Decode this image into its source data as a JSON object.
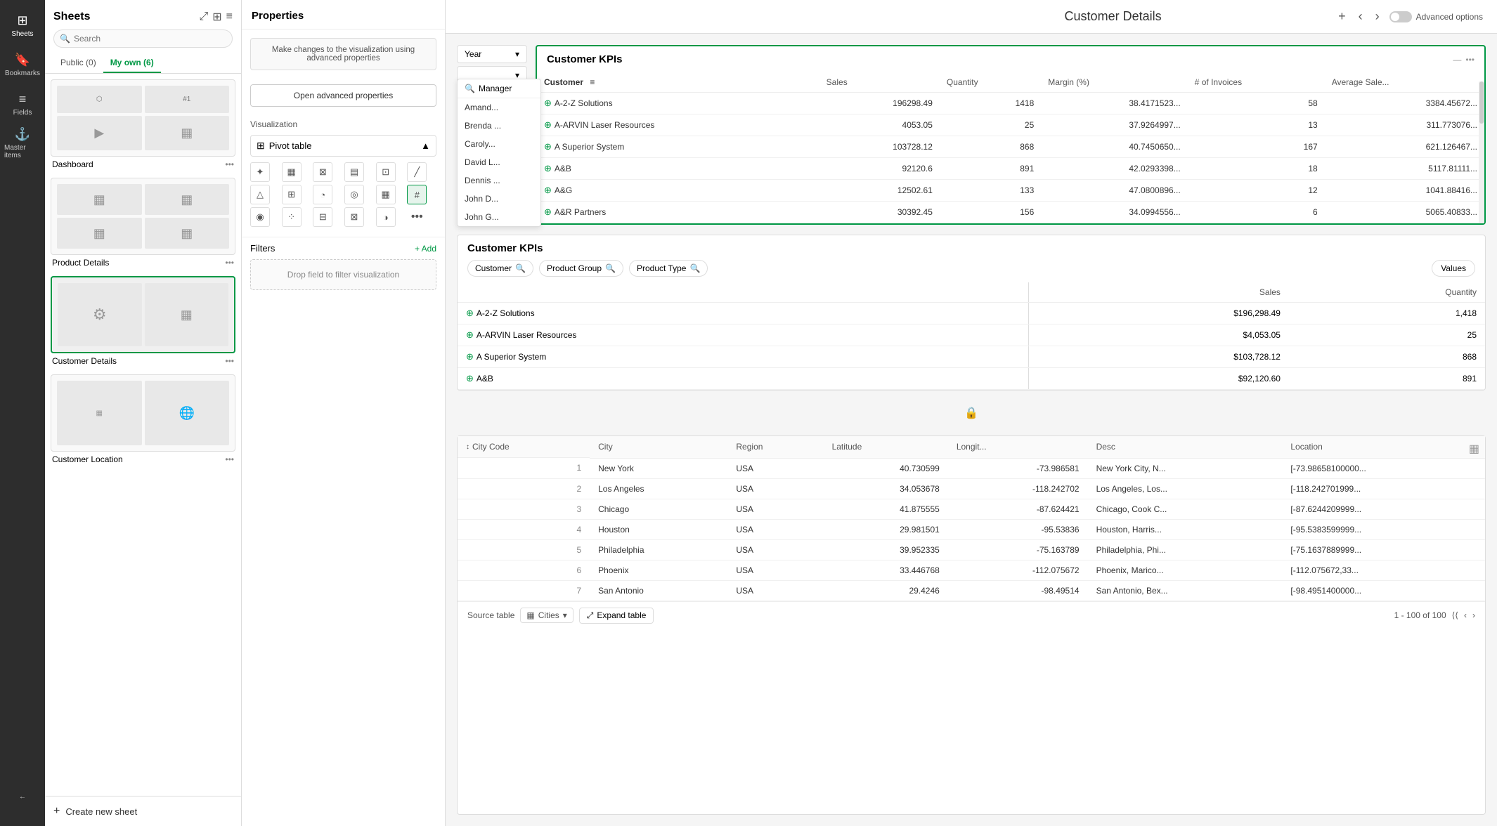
{
  "nav": {
    "items": [
      {
        "id": "sheets",
        "label": "Sheets",
        "icon": "⊞",
        "active": true
      },
      {
        "id": "bookmarks",
        "label": "Bookmarks",
        "icon": "🔖"
      },
      {
        "id": "fields",
        "label": "Fields",
        "icon": "⊟"
      },
      {
        "id": "master-items",
        "label": "Master items",
        "icon": "⚓"
      }
    ],
    "bottom_icon": "←"
  },
  "sheets_panel": {
    "title": "Sheets",
    "search_placeholder": "Search",
    "tabs": [
      {
        "id": "public",
        "label": "Public (0)",
        "active": false
      },
      {
        "id": "my-own",
        "label": "My own (6)",
        "active": true
      }
    ],
    "items": [
      {
        "id": "dashboard",
        "label": "Dashboard",
        "icons": [
          "⬡",
          "#1",
          "▶",
          "▦",
          "▲",
          "▦"
        ],
        "active": false
      },
      {
        "id": "product-details",
        "label": "Product Details",
        "icons": [
          "▦",
          "▦",
          "▦",
          "▦"
        ],
        "active": false
      },
      {
        "id": "customer-details",
        "label": "Customer Details",
        "icons": [
          "⚙",
          "▦"
        ],
        "active": true
      },
      {
        "id": "customer-location",
        "label": "Customer Location",
        "icons": [
          "▦",
          "🌐"
        ],
        "active": false
      }
    ],
    "create_label": "Create new sheet"
  },
  "properties": {
    "title": "Properties",
    "hint_text": "Make changes to the visualization using advanced properties",
    "open_btn": "Open advanced properties",
    "viz_section": "Visualization",
    "viz_type": "Pivot table",
    "filters_title": "Filters",
    "filters_add": "+ Add",
    "filters_drop": "Drop field to filter visualization"
  },
  "header": {
    "title": "Customer Details",
    "add_icon": "+",
    "prev_icon": "‹",
    "next_icon": "›",
    "adv_label": "Advanced options"
  },
  "filter_bar": {
    "label": "Year",
    "dropdown_icon": "▾"
  },
  "manager_popup": {
    "header": "Manager",
    "icon": "🔍",
    "items": [
      "Amand...",
      "Brenda ...",
      "Caroly...",
      "David L...",
      "Dennis ...",
      "John D...",
      "John G..."
    ]
  },
  "kpi_table1": {
    "title": "Customer KPIs",
    "columns": [
      "Customer",
      "Sales",
      "Quantity",
      "Margin (%)",
      "# of Invoices",
      "Average Sale..."
    ],
    "rows": [
      {
        "name": "A-2-Z Solutions",
        "sales": "196298.49",
        "quantity": "1418",
        "margin": "38.4171523...",
        "invoices": "58",
        "avg_sale": "3384.45672..."
      },
      {
        "name": "A-ARVIN Laser Resources",
        "sales": "4053.05",
        "quantity": "25",
        "margin": "37.9264997...",
        "invoices": "13",
        "avg_sale": "311.773076..."
      },
      {
        "name": "A Superior System",
        "sales": "103728.12",
        "quantity": "868",
        "margin": "40.7450650...",
        "invoices": "167",
        "avg_sale": "621.126467..."
      },
      {
        "name": "A&B",
        "sales": "92120.6",
        "quantity": "891",
        "margin": "42.0293398...",
        "invoices": "18",
        "avg_sale": "5117.81111..."
      },
      {
        "name": "A&G",
        "sales": "12502.61",
        "quantity": "133",
        "margin": "47.0800896...",
        "invoices": "12",
        "avg_sale": "1041.88416..."
      },
      {
        "name": "A&R Partners",
        "sales": "30392.45",
        "quantity": "156",
        "margin": "34.0994556...",
        "invoices": "6",
        "avg_sale": "5065.40833..."
      }
    ]
  },
  "kpi_table2": {
    "title": "Customer KPIs",
    "dims": [
      "Customer",
      "Product Group",
      "Product Type"
    ],
    "values_btn": "Values",
    "col_headers": [
      "Sales",
      "Quantity"
    ],
    "rows": [
      {
        "name": "A-2-Z Solutions",
        "sales": "$196,298.49",
        "quantity": "1,418"
      },
      {
        "name": "A-ARVIN Laser Resources",
        "sales": "$4,053.05",
        "quantity": "25"
      },
      {
        "name": "A Superior System",
        "sales": "$103,728.12",
        "quantity": "868"
      },
      {
        "name": "A&B",
        "sales": "$92,120.60",
        "quantity": "891"
      }
    ]
  },
  "source_table": {
    "lock_icon": "🔒",
    "columns": [
      "City Code",
      "City",
      "Region",
      "Latitude",
      "Longit...",
      "Desc",
      "Location"
    ],
    "rows": [
      {
        "num": "1",
        "city_code": "New York",
        "city": "New York",
        "region": "USA",
        "lat": "40.730599",
        "lng": "-73.986581",
        "desc": "New York City, N...",
        "location": "[-73.98658100000..."
      },
      {
        "num": "2",
        "city_code": "Los Angeles",
        "city": "Los Angeles",
        "region": "USA",
        "lat": "34.053678",
        "lng": "-118.242702",
        "desc": "Los Angeles, Los...",
        "location": "[-118.242701999..."
      },
      {
        "num": "3",
        "city_code": "Chicago",
        "city": "Chicago",
        "region": "USA",
        "lat": "41.875555",
        "lng": "-87.624421",
        "desc": "Chicago, Cook C...",
        "location": "[-87.6244209999..."
      },
      {
        "num": "4",
        "city_code": "Houston",
        "city": "Houston",
        "region": "USA",
        "lat": "29.981501",
        "lng": "-95.53836",
        "desc": "Houston, Harris...",
        "location": "[-95.5383599999..."
      },
      {
        "num": "5",
        "city_code": "Philadelphia",
        "city": "Philadelphia",
        "region": "USA",
        "lat": "39.952335",
        "lng": "-75.163789",
        "desc": "Philadelphia, Phi...",
        "location": "[-75.1637889999..."
      },
      {
        "num": "6",
        "city_code": "Phoenix",
        "city": "Phoenix",
        "region": "USA",
        "lat": "33.446768",
        "lng": "-112.075672",
        "desc": "Phoenix, Marico...",
        "location": "[-112.075672,33..."
      },
      {
        "num": "7",
        "city_code": "San Antonio",
        "city": "San Antonio",
        "region": "USA",
        "lat": "29.4246",
        "lng": "-98.49514",
        "desc": "San Antonio, Bex...",
        "location": "[-98.4951400000..."
      }
    ],
    "footer": {
      "source_label": "Source table",
      "cities_label": "Cities",
      "expand_label": "Expand table",
      "pagination": "1 - 100 of 100"
    }
  }
}
